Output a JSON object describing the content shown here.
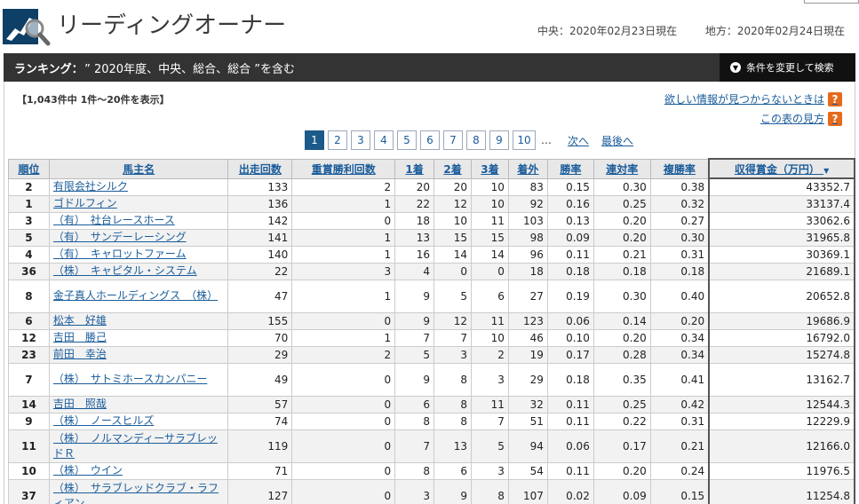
{
  "header": {
    "title": "リーディングオーナー",
    "date_central": "中央：2020年02月23日現在",
    "date_local": "地方：2020年02月24日現在"
  },
  "banner": {
    "label_bold": "ランキング：",
    "label_text": "” 2020年度、中央、総合、総合 ”を含む",
    "condition_button": "条件を変更して検索"
  },
  "summary": {
    "count_text": "【1,043件中 1件～20件を表示】",
    "help_missing": "欲しい情報が見つからないときは",
    "help_howto": "この表の見方"
  },
  "pager": {
    "pages": [
      "1",
      "2",
      "3",
      "4",
      "5",
      "6",
      "7",
      "8",
      "9",
      "10"
    ],
    "current": "1",
    "ellipsis": "…",
    "next": "次へ",
    "last": "最後へ"
  },
  "table": {
    "headers": [
      "順位",
      "馬主名",
      "出走回数",
      "重賞勝利回数",
      "1着",
      "2着",
      "3着",
      "着外",
      "勝率",
      "連対率",
      "複勝率",
      "収得賞金（万円）"
    ],
    "rows": [
      {
        "rank": "2",
        "name": "有限会社シルク",
        "runs": "133",
        "graded": "2",
        "w1": "20",
        "w2": "20",
        "w3": "10",
        "out": "83",
        "win": "0.15",
        "ren": "0.30",
        "fuku": "0.38",
        "prize": "43352.7"
      },
      {
        "rank": "1",
        "name": "ゴドルフィン",
        "runs": "136",
        "graded": "1",
        "w1": "22",
        "w2": "12",
        "w3": "10",
        "out": "92",
        "win": "0.16",
        "ren": "0.25",
        "fuku": "0.32",
        "prize": "33137.4"
      },
      {
        "rank": "3",
        "name": "（有）　社台レースホース",
        "runs": "142",
        "graded": "0",
        "w1": "18",
        "w2": "10",
        "w3": "11",
        "out": "103",
        "win": "0.13",
        "ren": "0.20",
        "fuku": "0.27",
        "prize": "33062.6"
      },
      {
        "rank": "5",
        "name": "（有）　サンデーレーシング",
        "runs": "141",
        "graded": "1",
        "w1": "13",
        "w2": "15",
        "w3": "15",
        "out": "98",
        "win": "0.09",
        "ren": "0.20",
        "fuku": "0.30",
        "prize": "31965.8"
      },
      {
        "rank": "4",
        "name": "（有）　キャロットファーム",
        "runs": "140",
        "graded": "1",
        "w1": "16",
        "w2": "14",
        "w3": "14",
        "out": "96",
        "win": "0.11",
        "ren": "0.21",
        "fuku": "0.31",
        "prize": "30369.1"
      },
      {
        "rank": "36",
        "name": "（株）　キャピタル・システム",
        "runs": "22",
        "graded": "3",
        "w1": "4",
        "w2": "0",
        "w3": "0",
        "out": "18",
        "win": "0.18",
        "ren": "0.18",
        "fuku": "0.18",
        "prize": "21689.1"
      },
      {
        "rank": "8",
        "name": "金子真人ホールディングス　（株）",
        "runs": "47",
        "graded": "1",
        "w1": "9",
        "w2": "5",
        "w3": "6",
        "out": "27",
        "win": "0.19",
        "ren": "0.30",
        "fuku": "0.40",
        "prize": "20652.8",
        "tall": true
      },
      {
        "rank": "6",
        "name": "松本　好雄",
        "runs": "155",
        "graded": "0",
        "w1": "9",
        "w2": "12",
        "w3": "11",
        "out": "123",
        "win": "0.06",
        "ren": "0.14",
        "fuku": "0.20",
        "prize": "19686.9"
      },
      {
        "rank": "12",
        "name": "吉田　勝己",
        "runs": "70",
        "graded": "1",
        "w1": "7",
        "w2": "7",
        "w3": "10",
        "out": "46",
        "win": "0.10",
        "ren": "0.20",
        "fuku": "0.34",
        "prize": "16792.0"
      },
      {
        "rank": "23",
        "name": "前田　幸治",
        "runs": "29",
        "graded": "2",
        "w1": "5",
        "w2": "3",
        "w3": "2",
        "out": "19",
        "win": "0.17",
        "ren": "0.28",
        "fuku": "0.34",
        "prize": "15274.8"
      },
      {
        "rank": "7",
        "name": "（株）　サトミホースカンパニー",
        "runs": "49",
        "graded": "0",
        "w1": "9",
        "w2": "8",
        "w3": "3",
        "out": "29",
        "win": "0.18",
        "ren": "0.35",
        "fuku": "0.41",
        "prize": "13162.7",
        "tall": true
      },
      {
        "rank": "14",
        "name": "吉田　照哉",
        "runs": "57",
        "graded": "0",
        "w1": "6",
        "w2": "8",
        "w3": "11",
        "out": "32",
        "win": "0.11",
        "ren": "0.25",
        "fuku": "0.42",
        "prize": "12544.3"
      },
      {
        "rank": "9",
        "name": "（株）　ノースヒルズ",
        "runs": "74",
        "graded": "0",
        "w1": "8",
        "w2": "8",
        "w3": "7",
        "out": "51",
        "win": "0.11",
        "ren": "0.22",
        "fuku": "0.31",
        "prize": "12229.9"
      },
      {
        "rank": "11",
        "name": "（株）　ノルマンディーサラブレッドＲ",
        "runs": "119",
        "graded": "0",
        "w1": "7",
        "w2": "13",
        "w3": "5",
        "out": "94",
        "win": "0.06",
        "ren": "0.17",
        "fuku": "0.21",
        "prize": "12166.0",
        "tall": true
      },
      {
        "rank": "10",
        "name": "（株）　ウイン",
        "runs": "71",
        "graded": "0",
        "w1": "8",
        "w2": "6",
        "w3": "3",
        "out": "54",
        "win": "0.11",
        "ren": "0.20",
        "fuku": "0.24",
        "prize": "11976.5"
      },
      {
        "rank": "37",
        "name": "（株）　サラブレッドクラブ・ラフィアン",
        "runs": "127",
        "graded": "0",
        "w1": "3",
        "w2": "9",
        "w3": "8",
        "out": "107",
        "win": "0.02",
        "ren": "0.09",
        "fuku": "0.15",
        "prize": "11254.8",
        "tall": true
      }
    ]
  }
}
